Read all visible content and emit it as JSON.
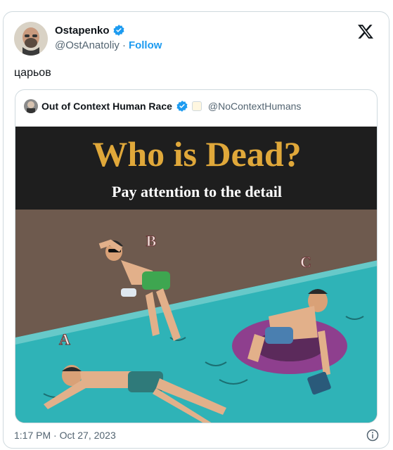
{
  "tweet": {
    "author": {
      "name": "Ostapenko",
      "handle": "@OstAnatoliy",
      "follow_label": "Follow",
      "separator": "·"
    },
    "text": "царьов",
    "timestamp": "1:17 PM · Oct 27, 2023",
    "brand_icon": "x-logo-icon",
    "info_icon": "info-icon"
  },
  "quote": {
    "author": {
      "name": "Out of Context Human Race",
      "handle": "@NoContextHumans"
    },
    "image": {
      "title": "Who is Dead?",
      "subtitle": "Pay attention to the detail",
      "labels": [
        "A",
        "B",
        "C"
      ]
    }
  },
  "colors": {
    "accent": "#1d9bf0",
    "border": "#cfd9de",
    "muted": "#536471",
    "meme_title": "#e0a83a",
    "water": "#2fb3b7",
    "sand": "#6e5a4e",
    "banner": "#1e1e1e"
  }
}
